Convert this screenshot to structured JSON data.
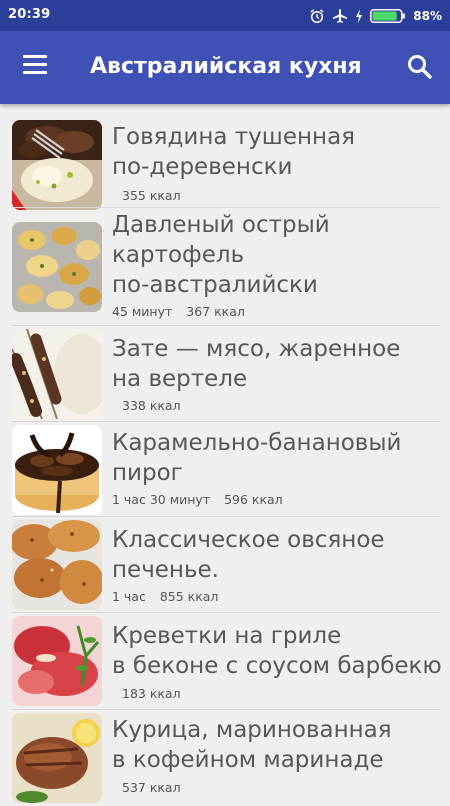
{
  "status_bar": {
    "time": "20:39",
    "battery_percent": "88%",
    "battery_level": 0.88,
    "icons": [
      "alarm-icon",
      "airplane-icon",
      "charging-icon",
      "battery-icon"
    ]
  },
  "app_bar": {
    "title": "Австралийская кухня",
    "menu_icon": "menu-icon",
    "search_icon": "search-icon"
  },
  "colors": {
    "status_bar": "#2b3e9a",
    "app_bar": "#3f51b5",
    "background": "#efefef",
    "title_text": "#585858"
  },
  "recipes": [
    {
      "title": "Говядина тушенная\nпо-деревенски",
      "time": "",
      "calories": "355 ккал"
    },
    {
      "title": "Давленый острый\nкартофель\nпо-австралийски",
      "time": "45 минут",
      "calories": "367 ккал"
    },
    {
      "title": "Зате — мясо, жаренное\nна вертеле",
      "time": "",
      "calories": "338 ккал"
    },
    {
      "title": "Карамельно-банановый\nпирог",
      "time": "1 час 30 минут",
      "calories": "596 ккал"
    },
    {
      "title": "Классическое овсяное\nпеченье.",
      "time": "1 час",
      "calories": "855 ккал"
    },
    {
      "title": "Креветки на гриле\nв беконе с соусом барбекю",
      "time": "",
      "calories": "183 ккал"
    },
    {
      "title": "Курица, маринованная\nв кофейном маринаде",
      "time": "",
      "calories": "537 ккал"
    }
  ]
}
